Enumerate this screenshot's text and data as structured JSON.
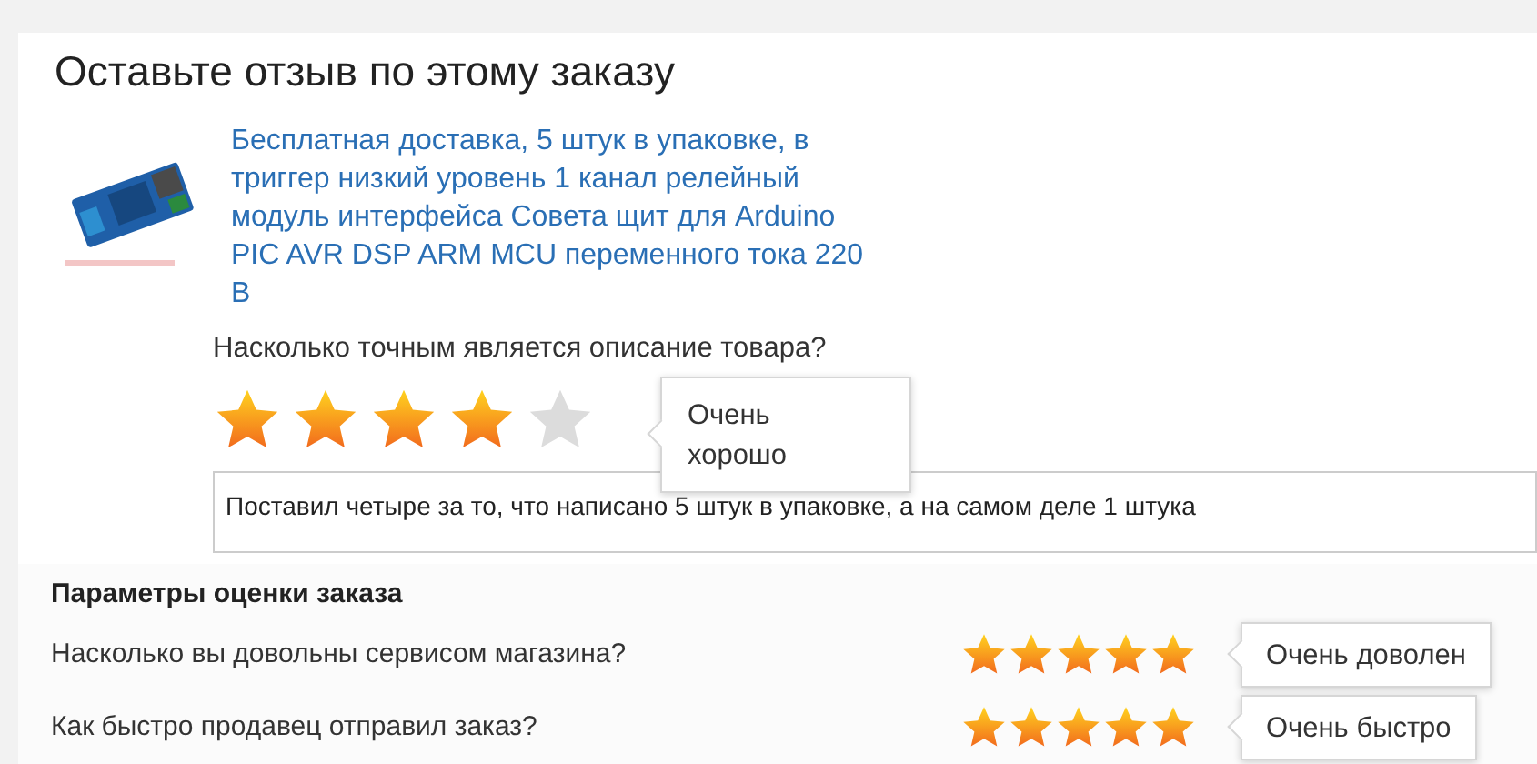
{
  "title": "Оставьте отзыв по этому заказу",
  "product": {
    "link": "Бесплатная доставка, 5 штук в упаковке, в триггер низкий уровень 1 канал релейный модуль интерфейса Совета щит для Arduino PIC AVR DSP ARM MCU переменного тока 220 В"
  },
  "description_rating": {
    "question": "Насколько точным является описание товара?",
    "stars": 4,
    "tooltip": "Очень хорошо"
  },
  "review": {
    "value": "Поставил четыре за то, что написано 5 штук в упаковке, а на самом деле 1 штука"
  },
  "parameters": {
    "heading": "Параметры оценки заказа",
    "rows": [
      {
        "question": "Насколько вы довольны сервисом магазина?",
        "stars": 5,
        "tooltip": "Очень доволен"
      },
      {
        "question": "Как быстро продавец отправил заказ?",
        "stars": 5,
        "tooltip": "Очень быстро"
      }
    ]
  }
}
